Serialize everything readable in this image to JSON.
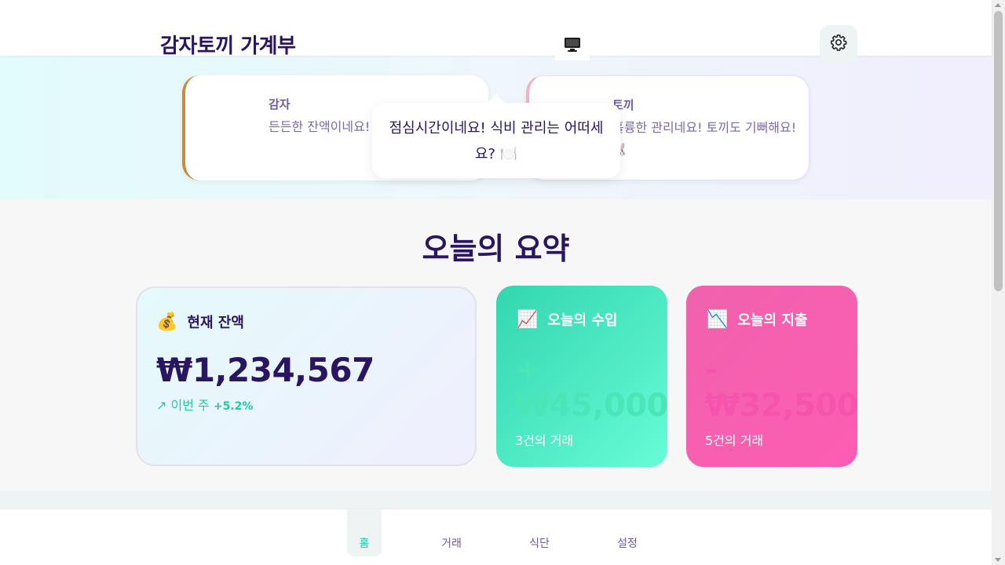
{
  "header": {
    "app_title": "감자토끼 가계부",
    "monitor_icon": "monitor-icon",
    "settings_icon": "gear-icon"
  },
  "characters": {
    "potato": {
      "name": "감자",
      "message": "든든한 잔액이네요! 잘하고 있어요! 🥔",
      "accent": "#c98a3c"
    },
    "rabbit": {
      "name": "토끼",
      "message": "훌륭한 관리네요! 토끼도 기뻐해요! 🐰",
      "accent": "#f5b0c5"
    }
  },
  "tooltip": {
    "text": "점심시간이네요! 식비 관리는 어떠세요? 🍽️"
  },
  "summary": {
    "title": "오늘의 요약",
    "balance": {
      "emoji": "💰",
      "label": "현재 잔액",
      "amount": "₩1,234,567",
      "trend_arrow": "↗",
      "trend_label": "이번 주",
      "trend_value": "+5.2%"
    },
    "income": {
      "emoji": "📈",
      "label": "오늘의 수입",
      "amount": "+ ₩45,000",
      "count": "3건의 거래",
      "color": "#33d6b0"
    },
    "expense": {
      "emoji": "📉",
      "label": "오늘의 지출",
      "amount": "- ₩32,500",
      "count": "5건의 거래",
      "color": "#f062ad"
    }
  },
  "nav": {
    "items": [
      {
        "label": "홈",
        "active": true
      },
      {
        "label": "거래",
        "active": false
      },
      {
        "label": "식단",
        "active": false
      },
      {
        "label": "설정",
        "active": false
      }
    ]
  }
}
